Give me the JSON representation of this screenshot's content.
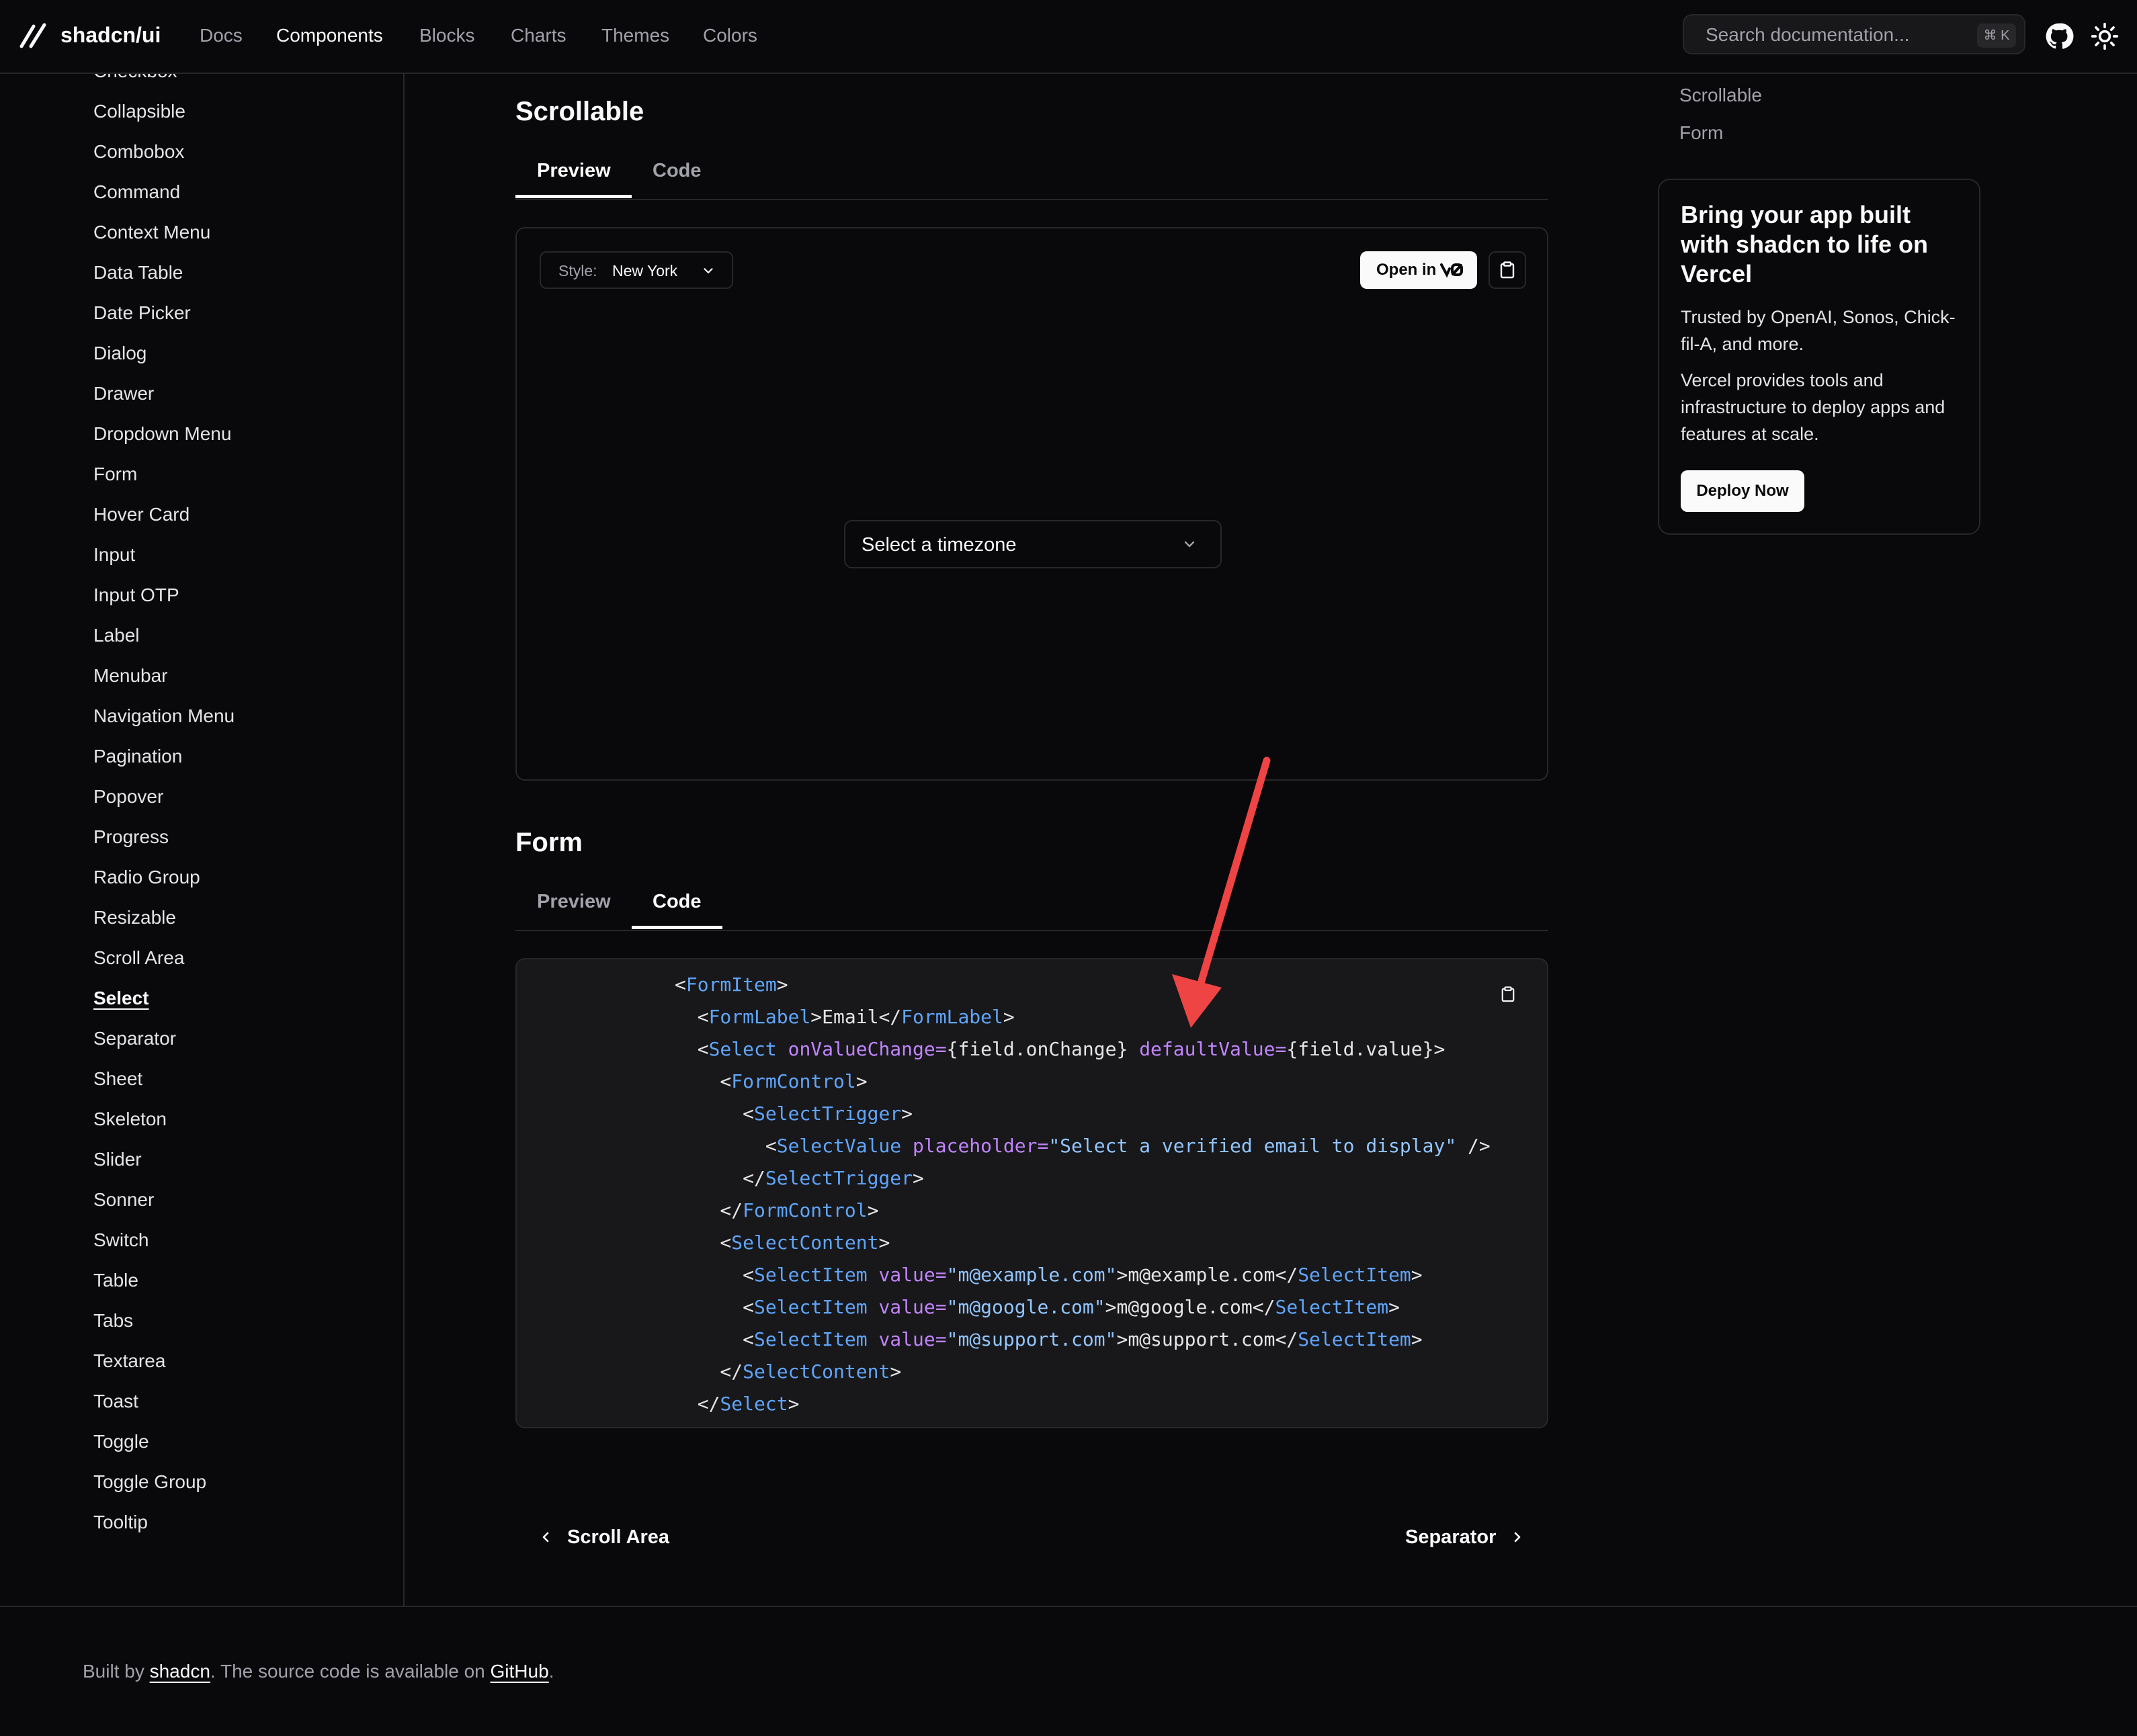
{
  "header": {
    "brand": "shadcn/ui",
    "nav": [
      "Docs",
      "Components",
      "Blocks",
      "Charts",
      "Themes",
      "Colors"
    ],
    "active_nav": "Components",
    "search": {
      "placeholder": "Search documentation...",
      "shortcut": "⌘ K"
    },
    "icons": [
      "github-icon",
      "sun-icon"
    ]
  },
  "sidebar": {
    "items": [
      "Checkbox",
      "Collapsible",
      "Combobox",
      "Command",
      "Context Menu",
      "Data Table",
      "Date Picker",
      "Dialog",
      "Drawer",
      "Dropdown Menu",
      "Form",
      "Hover Card",
      "Input",
      "Input OTP",
      "Label",
      "Menubar",
      "Navigation Menu",
      "Pagination",
      "Popover",
      "Progress",
      "Radio Group",
      "Resizable",
      "Scroll Area",
      "Select",
      "Separator",
      "Sheet",
      "Skeleton",
      "Slider",
      "Sonner",
      "Switch",
      "Table",
      "Tabs",
      "Textarea",
      "Toast",
      "Toggle",
      "Toggle Group",
      "Tooltip"
    ],
    "current": "Select"
  },
  "scrollable": {
    "title": "Scrollable",
    "tabs": [
      "Preview",
      "Code"
    ],
    "active_tab": "Preview",
    "style_label": "Style:",
    "style_value": "New York",
    "open_in_label": "Open in",
    "select_placeholder": "Select a timezone"
  },
  "form": {
    "title": "Form",
    "tabs": [
      "Preview",
      "Code"
    ],
    "active_tab": "Code",
    "code_lines": [
      [
        [
          "p",
          "<"
        ],
        [
          "t",
          "FormItem"
        ],
        [
          "p",
          ">"
        ]
      ],
      [
        [
          "p",
          "  <"
        ],
        [
          "t",
          "FormLabel"
        ],
        [
          "p",
          ">Email</"
        ],
        [
          "t",
          "FormLabel"
        ],
        [
          "p",
          ">"
        ]
      ],
      [
        [
          "p",
          "  <"
        ],
        [
          "t",
          "Select"
        ],
        [
          "p",
          " "
        ],
        [
          "a",
          "onValueChange"
        ],
        [
          "a",
          "="
        ],
        [
          "p",
          "{field.onChange} "
        ],
        [
          "a",
          "defaultValue"
        ],
        [
          "a",
          "="
        ],
        [
          "p",
          "{field.value}>"
        ]
      ],
      [
        [
          "p",
          "    <"
        ],
        [
          "t",
          "FormControl"
        ],
        [
          "p",
          ">"
        ]
      ],
      [
        [
          "p",
          "      <"
        ],
        [
          "t",
          "SelectTrigger"
        ],
        [
          "p",
          ">"
        ]
      ],
      [
        [
          "p",
          "        <"
        ],
        [
          "t",
          "SelectValue"
        ],
        [
          "p",
          " "
        ],
        [
          "a",
          "placeholder"
        ],
        [
          "a",
          "="
        ],
        [
          "s",
          "\"Select a verified email to display\""
        ],
        [
          "p",
          " />"
        ]
      ],
      [
        [
          "p",
          "      </"
        ],
        [
          "t",
          "SelectTrigger"
        ],
        [
          "p",
          ">"
        ]
      ],
      [
        [
          "p",
          "    </"
        ],
        [
          "t",
          "FormControl"
        ],
        [
          "p",
          ">"
        ]
      ],
      [
        [
          "p",
          "    <"
        ],
        [
          "t",
          "SelectContent"
        ],
        [
          "p",
          ">"
        ]
      ],
      [
        [
          "p",
          "      <"
        ],
        [
          "t",
          "SelectItem"
        ],
        [
          "p",
          " "
        ],
        [
          "a",
          "value"
        ],
        [
          "a",
          "="
        ],
        [
          "s",
          "\"m@example.com\""
        ],
        [
          "p",
          ">m@example.com</"
        ],
        [
          "t",
          "SelectItem"
        ],
        [
          "p",
          ">"
        ]
      ],
      [
        [
          "p",
          "      <"
        ],
        [
          "t",
          "SelectItem"
        ],
        [
          "p",
          " "
        ],
        [
          "a",
          "value"
        ],
        [
          "a",
          "="
        ],
        [
          "s",
          "\"m@google.com\""
        ],
        [
          "p",
          ">m@google.com</"
        ],
        [
          "t",
          "SelectItem"
        ],
        [
          "p",
          ">"
        ]
      ],
      [
        [
          "p",
          "      <"
        ],
        [
          "t",
          "SelectItem"
        ],
        [
          "p",
          " "
        ],
        [
          "a",
          "value"
        ],
        [
          "a",
          "="
        ],
        [
          "s",
          "\"m@support.com\""
        ],
        [
          "p",
          ">m@support.com</"
        ],
        [
          "t",
          "SelectItem"
        ],
        [
          "p",
          ">"
        ]
      ],
      [
        [
          "p",
          "    </"
        ],
        [
          "t",
          "SelectContent"
        ],
        [
          "p",
          ">"
        ]
      ],
      [
        [
          "p",
          "  </"
        ],
        [
          "t",
          "Select"
        ],
        [
          "p",
          ">"
        ]
      ]
    ]
  },
  "toc": [
    "Scrollable",
    "Form"
  ],
  "promo": {
    "heading": "Bring your app built with shadcn to life on Vercel",
    "p1": "Trusted by OpenAI, Sonos, Chick-fil-A, and more.",
    "p2": "Vercel provides tools and infrastructure to deploy apps and features at scale.",
    "button": "Deploy Now"
  },
  "pager": {
    "prev": "Scroll Area",
    "next": "Separator"
  },
  "footer": {
    "prefix": "Built by ",
    "author": "shadcn",
    "middle": ". The source code is available on ",
    "repo": "GitHub",
    "suffix": "."
  },
  "colors": {
    "background": "#09090b",
    "border": "#27272a",
    "annotation_arrow": "#ef4444"
  }
}
